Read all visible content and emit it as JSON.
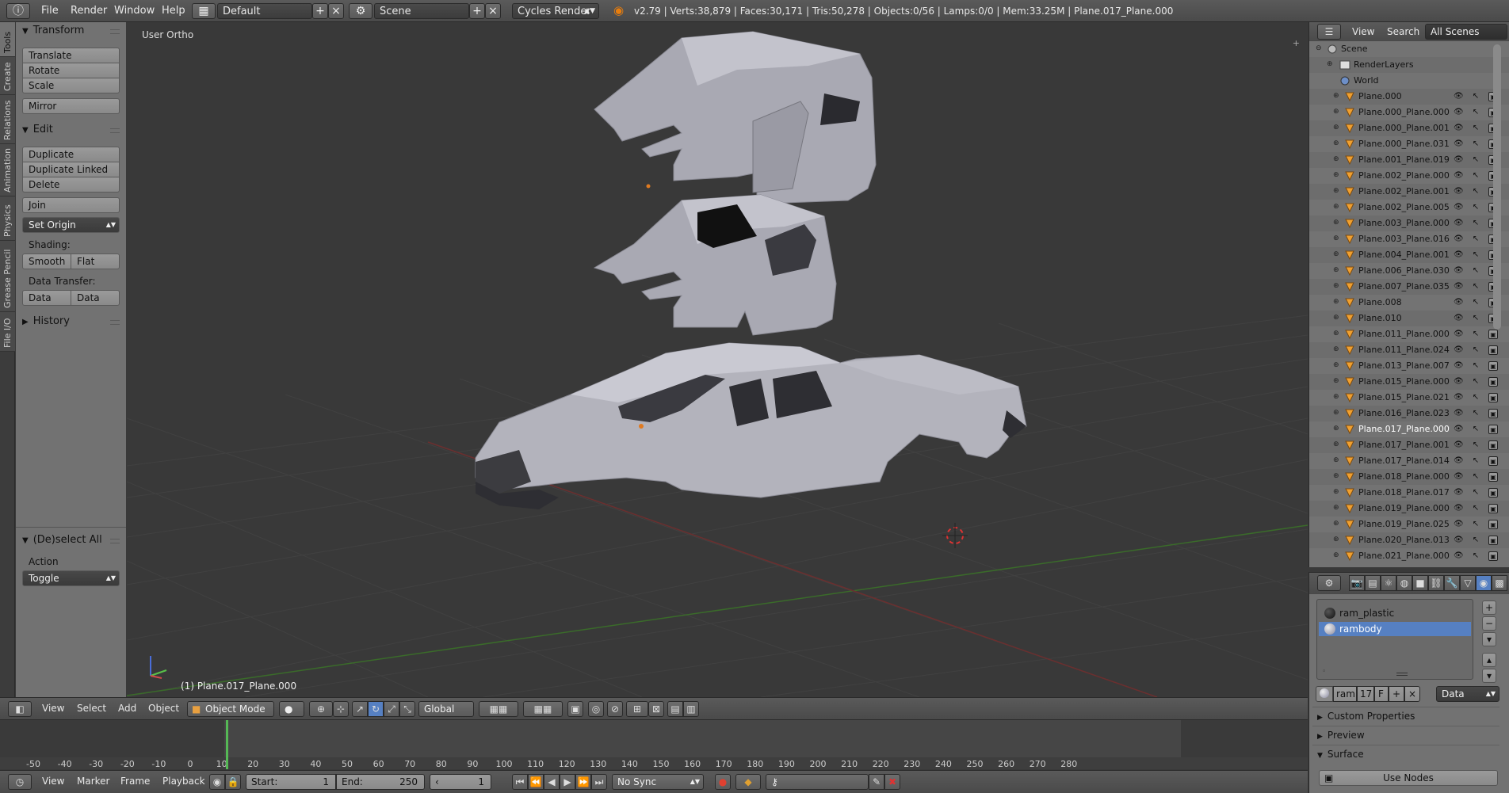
{
  "topbar": {
    "menus": [
      "File",
      "Render",
      "Window",
      "Help"
    ],
    "layout": "Default",
    "scene": "Scene",
    "engine": "Cycles Render",
    "stats": "v2.79 | Verts:38,879 | Faces:30,171 | Tris:50,278 | Objects:0/56 | Lamps:0/0 | Mem:33.25M | Plane.017_Plane.000"
  },
  "tool_tabs": [
    "Tools",
    "Create",
    "Relations",
    "Animation",
    "Physics",
    "Grease Pencil",
    "File I/O"
  ],
  "tool_shelf": {
    "transform_title": "Transform",
    "translate": "Translate",
    "rotate": "Rotate",
    "scale": "Scale",
    "mirror": "Mirror",
    "edit_title": "Edit",
    "duplicate": "Duplicate",
    "duplicate_linked": "Duplicate Linked",
    "delete": "Delete",
    "join": "Join",
    "set_origin": "Set Origin",
    "shading_label": "Shading:",
    "smooth": "Smooth",
    "flat": "Flat",
    "data_transfer_label": "Data Transfer:",
    "data": "Data",
    "data_layout": "Data Layo",
    "history_title": "History",
    "deselect_title": "(De)select All",
    "action_label": "Action",
    "action_value": "Toggle"
  },
  "viewport": {
    "view_label": "User Ortho",
    "object_label": "(1) Plane.017_Plane.000"
  },
  "viewport_header": {
    "menus": [
      "View",
      "Select",
      "Add",
      "Object"
    ],
    "mode": "Object Mode",
    "orientation": "Global"
  },
  "timeline": {
    "ticks": [
      "-50",
      "-40",
      "-30",
      "-20",
      "-10",
      "0",
      "10",
      "20",
      "30",
      "40",
      "50",
      "60",
      "70",
      "80",
      "90",
      "100",
      "110",
      "120",
      "130",
      "140",
      "150",
      "160",
      "170",
      "180",
      "190",
      "200",
      "210",
      "220",
      "230",
      "240",
      "250",
      "260",
      "270",
      "280"
    ],
    "current_frame": 1
  },
  "timeline_header": {
    "menus": [
      "View",
      "Marker",
      "Frame",
      "Playback"
    ],
    "start_label": "Start:",
    "start_value": "1",
    "end_label": "End:",
    "end_value": "250",
    "frame_value": "1",
    "sync": "No Sync"
  },
  "outliner_header": {
    "view": "View",
    "search": "Search",
    "filter": "All Scenes"
  },
  "outliner": {
    "scene": "Scene",
    "render_layers": "RenderLayers",
    "world": "World",
    "objects": [
      "Plane.000",
      "Plane.000_Plane.000",
      "Plane.000_Plane.001",
      "Plane.000_Plane.031",
      "Plane.001_Plane.019",
      "Plane.002_Plane.000",
      "Plane.002_Plane.001",
      "Plane.002_Plane.005",
      "Plane.003_Plane.000",
      "Plane.003_Plane.016",
      "Plane.004_Plane.001",
      "Plane.006_Plane.030",
      "Plane.007_Plane.035",
      "Plane.008",
      "Plane.010",
      "Plane.011_Plane.000",
      "Plane.011_Plane.024",
      "Plane.013_Plane.007",
      "Plane.015_Plane.000",
      "Plane.015_Plane.021",
      "Plane.016_Plane.023",
      "Plane.017_Plane.000",
      "Plane.017_Plane.001",
      "Plane.017_Plane.014",
      "Plane.018_Plane.000",
      "Plane.018_Plane.017",
      "Plane.019_Plane.000",
      "Plane.019_Plane.025",
      "Plane.020_Plane.013",
      "Plane.021_Plane.000"
    ],
    "active": "Plane.017_Plane.000"
  },
  "properties": {
    "materials": [
      "ram_plastic",
      "rambody"
    ],
    "selected_material": "rambody",
    "material_field": "ramb",
    "users": "17",
    "fake": "F",
    "link": "Data",
    "panels": [
      "Custom Properties",
      "Preview",
      "Surface"
    ],
    "use_nodes": "Use Nodes"
  },
  "colors": {
    "accent": "#5680c2",
    "panel": "#727272",
    "viewport": "#393939",
    "header": "#4a4a4a"
  }
}
